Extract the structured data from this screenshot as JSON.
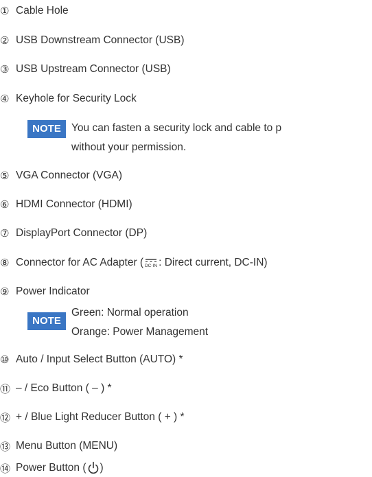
{
  "items": [
    {
      "num": "①",
      "label": "Cable Hole"
    },
    {
      "num": "②",
      "label": "USB Downstream Connector (USB)"
    },
    {
      "num": "③",
      "label": "USB Upstream Connector (USB)"
    },
    {
      "num": "④",
      "label": "Keyhole for Security Lock"
    },
    {
      "num": "⑤",
      "label": "VGA Connector (VGA)"
    },
    {
      "num": "⑥",
      "label": "HDMI Connector (HDMI)"
    },
    {
      "num": "⑦",
      "label": "DisplayPort Connector (DP)"
    },
    {
      "num": "⑧",
      "label_prefix": "Connector for AC Adapter (",
      "label_suffix": ": Direct current, DC-IN)"
    },
    {
      "num": "⑨",
      "label": "Power Indicator"
    },
    {
      "num": "⑩",
      "label": "Auto / Input Select Button (AUTO) *"
    },
    {
      "num": "⑪",
      "label": "– / Eco Button ( – ) *"
    },
    {
      "num": "⑫",
      "label": "+ / Blue Light Reducer Button ( + ) *"
    },
    {
      "num": "⑬",
      "label": "Menu Button (MENU)"
    },
    {
      "num": "⑭",
      "label_prefix": "Power Button (",
      "label_suffix": ")"
    }
  ],
  "note1": {
    "badge": "NOTE",
    "line1": "You can fasten a security lock and cable to p",
    "line2": "without your permission."
  },
  "note2": {
    "badge": "NOTE",
    "line1": "Green:   Normal operation",
    "line2": "Orange: Power Management"
  },
  "colors": {
    "note_badge": "#3a76c4",
    "text": "#333333"
  },
  "icons": {
    "dc": "dc-in-symbol-icon",
    "power": "power-icon"
  }
}
